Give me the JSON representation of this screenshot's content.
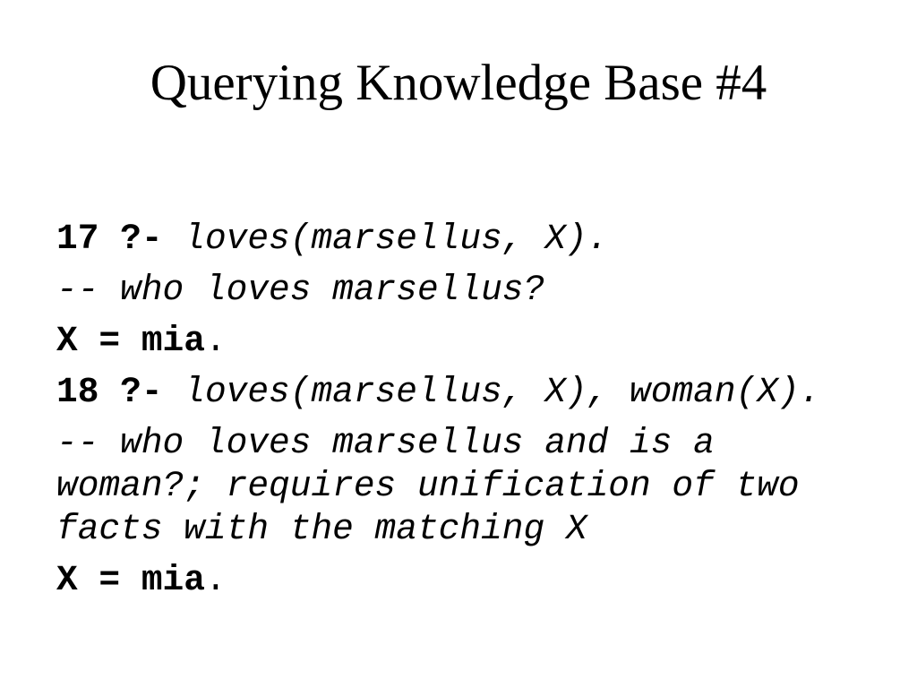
{
  "slide": {
    "title": "Querying Knowledge Base #4",
    "lines": [
      {
        "prompt": "17 ?- ",
        "query": "loves(marsellus, X)."
      },
      {
        "comment": "-- who loves marsellus?"
      },
      {
        "answer": "X = mia",
        "period": "."
      },
      {
        "prompt": "18 ?- ",
        "query": "loves(marsellus, X), woman(X)."
      },
      {
        "comment": "-- who loves marsellus and is a woman?; requires unification of two facts with the matching X"
      },
      {
        "answer": "X = mia",
        "period": "."
      }
    ]
  }
}
